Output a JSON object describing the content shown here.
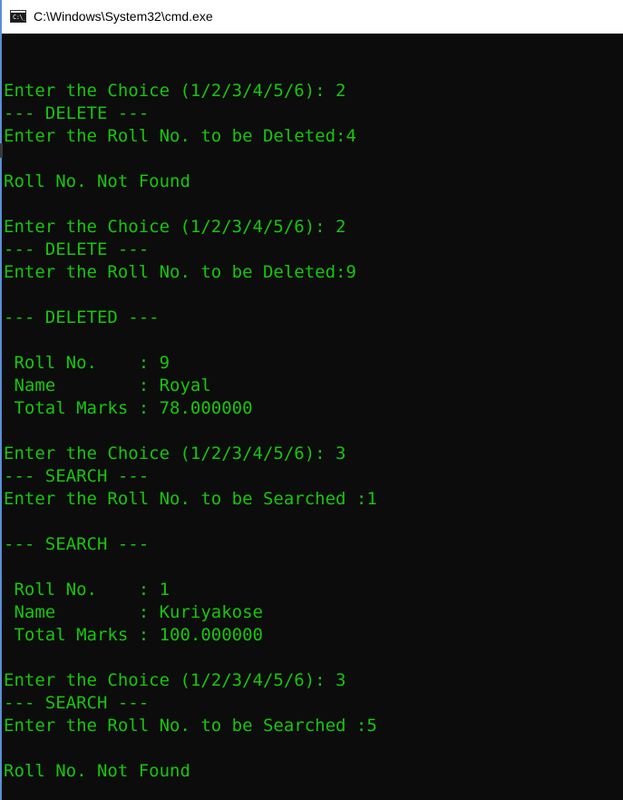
{
  "window": {
    "title": "C:\\Windows\\System32\\cmd.exe",
    "icon": "cmd-icon",
    "icon_glyph": "C:\\_",
    "accent_color": "#16c60c",
    "background_color": "#0c0c0c"
  },
  "console": {
    "lines": [
      "Enter the Choice (1/2/3/4/5/6): 2",
      "--- DELETE ---",
      "Enter the Roll No. to be Deleted:4",
      "",
      "Roll No. Not Found",
      "",
      "Enter the Choice (1/2/3/4/5/6): 2",
      "--- DELETE ---",
      "Enter the Roll No. to be Deleted:9",
      "",
      "--- DELETED ---",
      "",
      " Roll No.    : 9",
      " Name        : Royal",
      " Total Marks : 78.000000",
      "",
      "Enter the Choice (1/2/3/4/5/6): 3",
      "--- SEARCH ---",
      "Enter the Roll No. to be Searched :1",
      "",
      "--- SEARCH ---",
      "",
      " Roll No.    : 1",
      " Name        : Kuriyakose",
      " Total Marks : 100.000000",
      "",
      "Enter the Choice (1/2/3/4/5/6): 3",
      "--- SEARCH ---",
      "Enter the Roll No. to be Searched :5",
      "",
      "Roll No. Not Found"
    ]
  }
}
